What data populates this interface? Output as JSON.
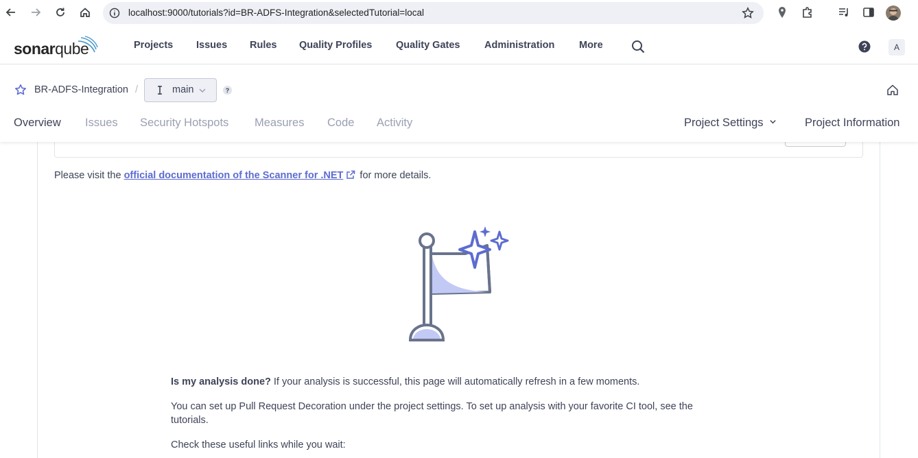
{
  "browser": {
    "url": "localhost:9000/tutorials?id=BR-ADFS-Integration&selectedTutorial=local",
    "icons": [
      "back-icon",
      "forward-icon",
      "reload-icon",
      "home-icon",
      "site-info-icon",
      "bookmark-star-icon",
      "location-icon",
      "extensions-icon",
      "media-icon",
      "side-panel-icon",
      "profile-avatar"
    ]
  },
  "topbar": {
    "logo_bold": "sonar",
    "logo_light": "qube",
    "nav": [
      {
        "label": "Projects"
      },
      {
        "label": "Issues"
      },
      {
        "label": "Rules"
      },
      {
        "label": "Quality Profiles"
      },
      {
        "label": "Quality Gates"
      },
      {
        "label": "Administration"
      },
      {
        "label": "More"
      }
    ],
    "avatar_letter": "A"
  },
  "project": {
    "name": "BR-ADFS-Integration",
    "separator": "/",
    "branch": "main",
    "help_badge": "?",
    "tabs": [
      {
        "label": "Overview",
        "active": true
      },
      {
        "label": "Issues",
        "active": false
      },
      {
        "label": "Security Hotspots",
        "active": false
      },
      {
        "label": "Measures",
        "active": false
      },
      {
        "label": "Code",
        "active": false
      },
      {
        "label": "Activity",
        "active": false
      }
    ],
    "settings_label": "Project Settings",
    "info_label": "Project Information"
  },
  "content": {
    "doc_prefix": "Please visit the ",
    "doc_link": "official documentation of the Scanner for .NET",
    "doc_suffix": " for more details.",
    "analysis_q": "Is my analysis done?",
    "analysis_text": " If your analysis is successful, this page will automatically refresh in a few moments.",
    "pr_text_1": "You can set up Pull Request Decoration under the project settings. To set up analysis with your favorite CI tool, see the",
    "pr_text_2": "tutorials.",
    "links_text": "Check these useful links while you wait:"
  },
  "colors": {
    "accent": "#5d6cd0",
    "text": "#3e4357",
    "muted": "#9aa0b2",
    "illustration_stroke": "#69738c",
    "illustration_fill": "#c3c9f5"
  }
}
